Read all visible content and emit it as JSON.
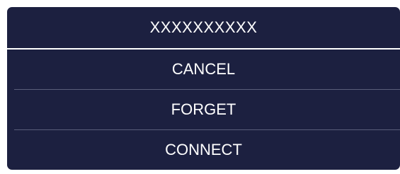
{
  "dialog": {
    "title": "XXXXXXXXXX",
    "options": [
      {
        "label": "CANCEL"
      },
      {
        "label": "FORGET"
      },
      {
        "label": "CONNECT"
      }
    ]
  },
  "colors": {
    "background": "#1c2040",
    "text": "#ffffff",
    "title_divider": "#ffffff",
    "option_divider": "#5a5e7a"
  }
}
